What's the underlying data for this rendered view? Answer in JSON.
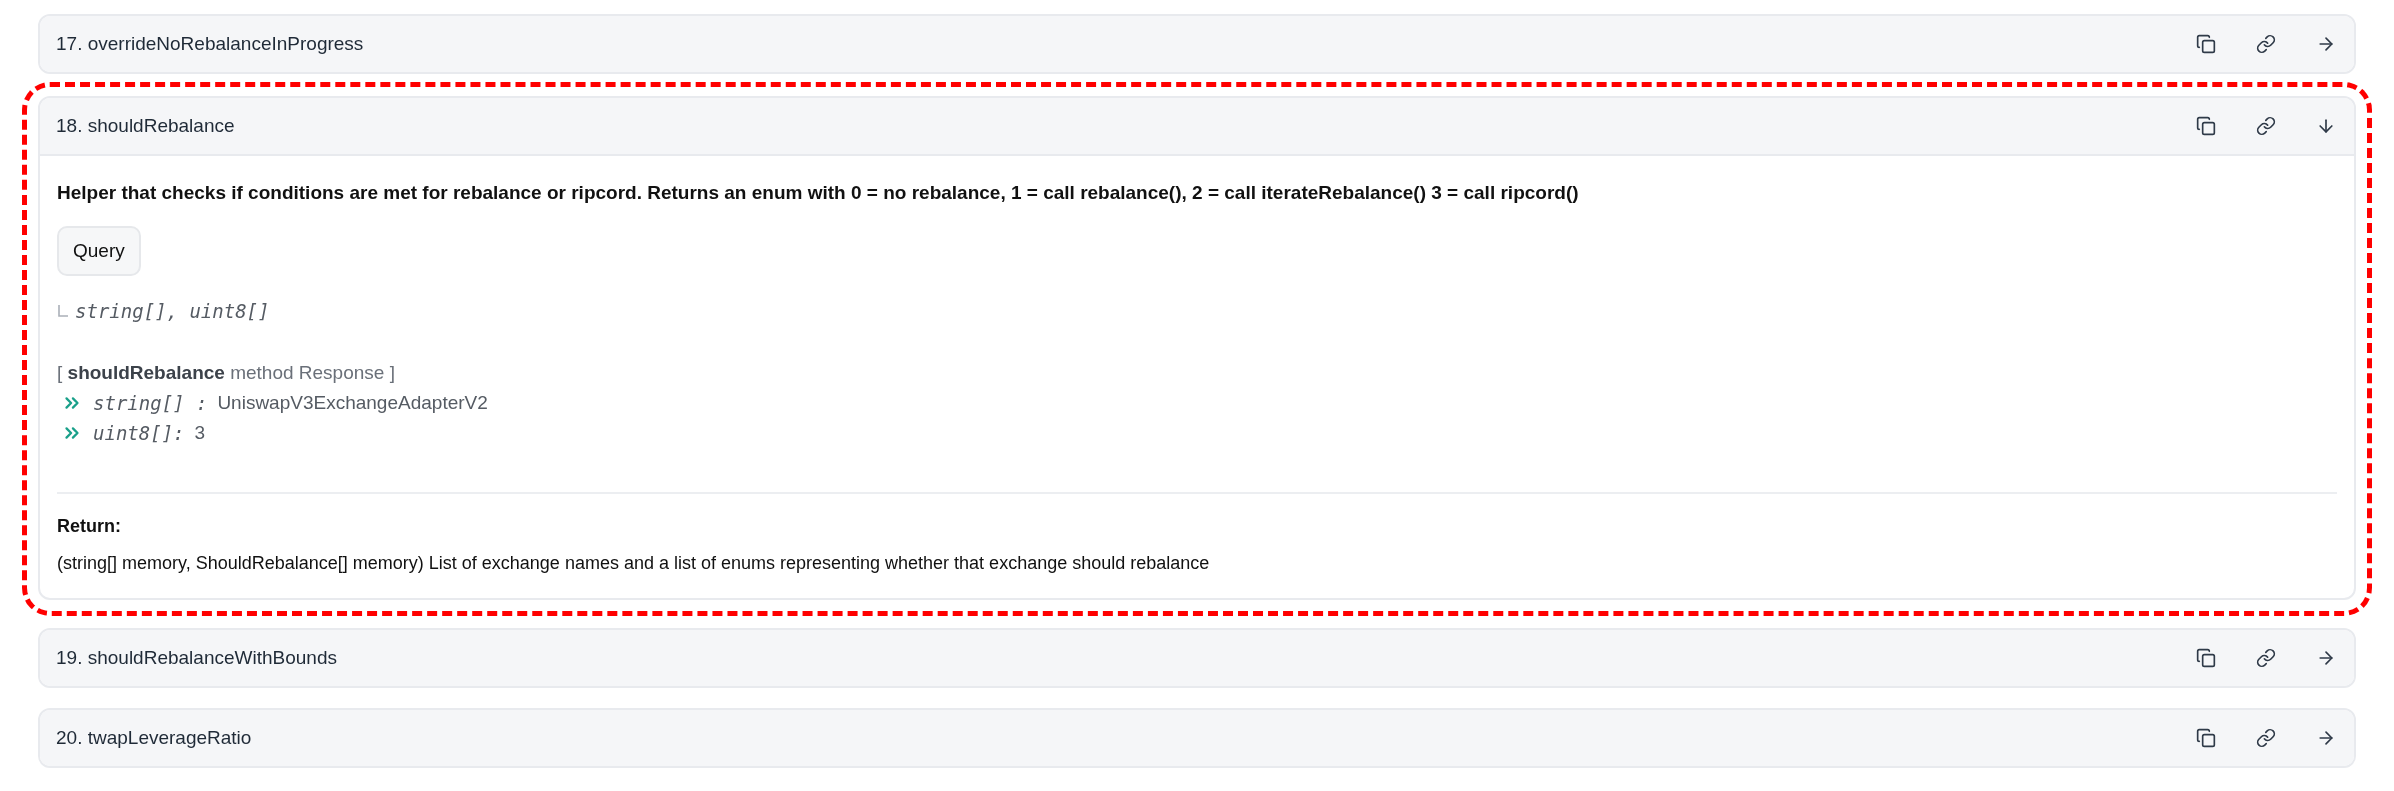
{
  "functions": [
    {
      "title": "17. overrideNoRebalanceInProgress",
      "expanded": false,
      "highlighted": false
    },
    {
      "title": "18. shouldRebalance",
      "expanded": true,
      "highlighted": true,
      "description": "Helper that checks if conditions are met for rebalance or ripcord. Returns an enum with 0 = no rebalance, 1 = call rebalance(), 2 = call iterateRebalance() 3 = call ripcord()",
      "query_button": "Query",
      "output_types": "string[], uint8[]",
      "response_header": "[ **shouldRebalance** method Response ]",
      "response": [
        {
          "type": "string[] :",
          "value": "UniswapV3ExchangeAdapterV2"
        },
        {
          "type": "uint8[]:",
          "value": "3"
        }
      ],
      "return_label": "Return:",
      "return_text": "(string[] memory, ShouldRebalance[] memory) List of exchange names and a list of enums representing whether that exchange should rebalance"
    },
    {
      "title": "19. shouldRebalanceWithBounds",
      "expanded": false,
      "highlighted": false
    },
    {
      "title": "20. twapLeverageRatio",
      "expanded": false,
      "highlighted": false
    }
  ]
}
